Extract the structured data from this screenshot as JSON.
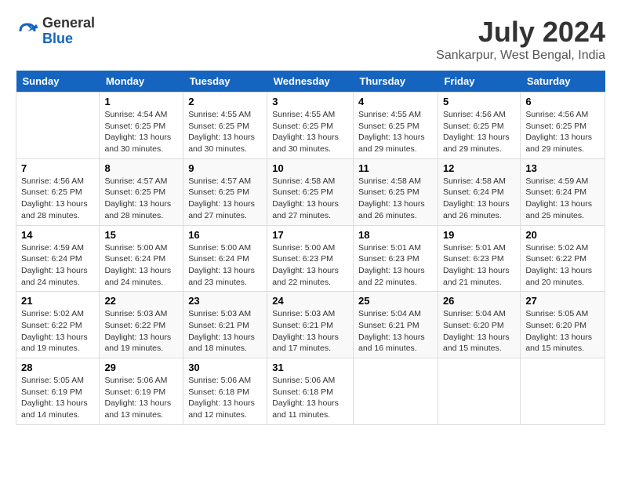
{
  "logo": {
    "general": "General",
    "blue": "Blue"
  },
  "title": {
    "month_year": "July 2024",
    "location": "Sankarpur, West Bengal, India"
  },
  "headers": [
    "Sunday",
    "Monday",
    "Tuesday",
    "Wednesday",
    "Thursday",
    "Friday",
    "Saturday"
  ],
  "weeks": [
    [
      {
        "day": "",
        "info": ""
      },
      {
        "day": "1",
        "info": "Sunrise: 4:54 AM\nSunset: 6:25 PM\nDaylight: 13 hours\nand 30 minutes."
      },
      {
        "day": "2",
        "info": "Sunrise: 4:55 AM\nSunset: 6:25 PM\nDaylight: 13 hours\nand 30 minutes."
      },
      {
        "day": "3",
        "info": "Sunrise: 4:55 AM\nSunset: 6:25 PM\nDaylight: 13 hours\nand 30 minutes."
      },
      {
        "day": "4",
        "info": "Sunrise: 4:55 AM\nSunset: 6:25 PM\nDaylight: 13 hours\nand 29 minutes."
      },
      {
        "day": "5",
        "info": "Sunrise: 4:56 AM\nSunset: 6:25 PM\nDaylight: 13 hours\nand 29 minutes."
      },
      {
        "day": "6",
        "info": "Sunrise: 4:56 AM\nSunset: 6:25 PM\nDaylight: 13 hours\nand 29 minutes."
      }
    ],
    [
      {
        "day": "7",
        "info": "Sunrise: 4:56 AM\nSunset: 6:25 PM\nDaylight: 13 hours\nand 28 minutes."
      },
      {
        "day": "8",
        "info": "Sunrise: 4:57 AM\nSunset: 6:25 PM\nDaylight: 13 hours\nand 28 minutes."
      },
      {
        "day": "9",
        "info": "Sunrise: 4:57 AM\nSunset: 6:25 PM\nDaylight: 13 hours\nand 27 minutes."
      },
      {
        "day": "10",
        "info": "Sunrise: 4:58 AM\nSunset: 6:25 PM\nDaylight: 13 hours\nand 27 minutes."
      },
      {
        "day": "11",
        "info": "Sunrise: 4:58 AM\nSunset: 6:25 PM\nDaylight: 13 hours\nand 26 minutes."
      },
      {
        "day": "12",
        "info": "Sunrise: 4:58 AM\nSunset: 6:24 PM\nDaylight: 13 hours\nand 26 minutes."
      },
      {
        "day": "13",
        "info": "Sunrise: 4:59 AM\nSunset: 6:24 PM\nDaylight: 13 hours\nand 25 minutes."
      }
    ],
    [
      {
        "day": "14",
        "info": "Sunrise: 4:59 AM\nSunset: 6:24 PM\nDaylight: 13 hours\nand 24 minutes."
      },
      {
        "day": "15",
        "info": "Sunrise: 5:00 AM\nSunset: 6:24 PM\nDaylight: 13 hours\nand 24 minutes."
      },
      {
        "day": "16",
        "info": "Sunrise: 5:00 AM\nSunset: 6:24 PM\nDaylight: 13 hours\nand 23 minutes."
      },
      {
        "day": "17",
        "info": "Sunrise: 5:00 AM\nSunset: 6:23 PM\nDaylight: 13 hours\nand 22 minutes."
      },
      {
        "day": "18",
        "info": "Sunrise: 5:01 AM\nSunset: 6:23 PM\nDaylight: 13 hours\nand 22 minutes."
      },
      {
        "day": "19",
        "info": "Sunrise: 5:01 AM\nSunset: 6:23 PM\nDaylight: 13 hours\nand 21 minutes."
      },
      {
        "day": "20",
        "info": "Sunrise: 5:02 AM\nSunset: 6:22 PM\nDaylight: 13 hours\nand 20 minutes."
      }
    ],
    [
      {
        "day": "21",
        "info": "Sunrise: 5:02 AM\nSunset: 6:22 PM\nDaylight: 13 hours\nand 19 minutes."
      },
      {
        "day": "22",
        "info": "Sunrise: 5:03 AM\nSunset: 6:22 PM\nDaylight: 13 hours\nand 19 minutes."
      },
      {
        "day": "23",
        "info": "Sunrise: 5:03 AM\nSunset: 6:21 PM\nDaylight: 13 hours\nand 18 minutes."
      },
      {
        "day": "24",
        "info": "Sunrise: 5:03 AM\nSunset: 6:21 PM\nDaylight: 13 hours\nand 17 minutes."
      },
      {
        "day": "25",
        "info": "Sunrise: 5:04 AM\nSunset: 6:21 PM\nDaylight: 13 hours\nand 16 minutes."
      },
      {
        "day": "26",
        "info": "Sunrise: 5:04 AM\nSunset: 6:20 PM\nDaylight: 13 hours\nand 15 minutes."
      },
      {
        "day": "27",
        "info": "Sunrise: 5:05 AM\nSunset: 6:20 PM\nDaylight: 13 hours\nand 15 minutes."
      }
    ],
    [
      {
        "day": "28",
        "info": "Sunrise: 5:05 AM\nSunset: 6:19 PM\nDaylight: 13 hours\nand 14 minutes."
      },
      {
        "day": "29",
        "info": "Sunrise: 5:06 AM\nSunset: 6:19 PM\nDaylight: 13 hours\nand 13 minutes."
      },
      {
        "day": "30",
        "info": "Sunrise: 5:06 AM\nSunset: 6:18 PM\nDaylight: 13 hours\nand 12 minutes."
      },
      {
        "day": "31",
        "info": "Sunrise: 5:06 AM\nSunset: 6:18 PM\nDaylight: 13 hours\nand 11 minutes."
      },
      {
        "day": "",
        "info": ""
      },
      {
        "day": "",
        "info": ""
      },
      {
        "day": "",
        "info": ""
      }
    ]
  ]
}
